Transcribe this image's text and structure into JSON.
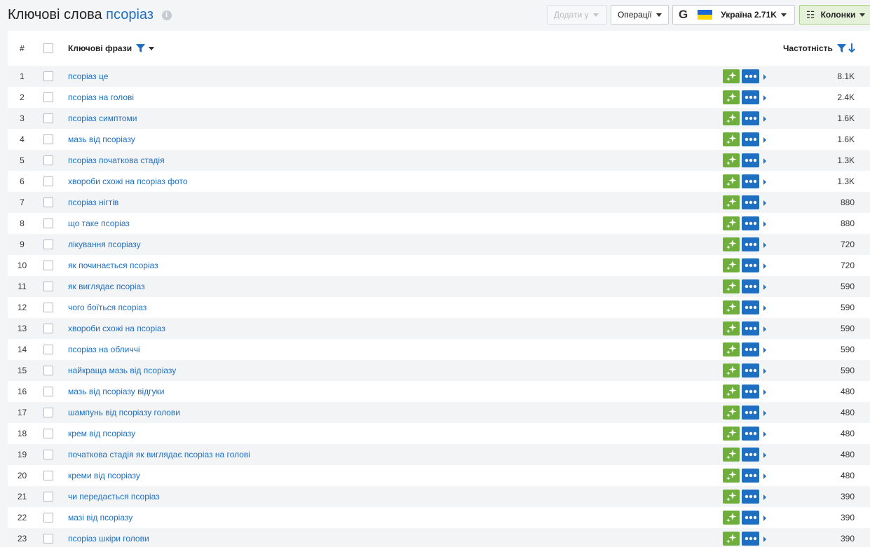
{
  "header": {
    "title_prefix": "Ключові слова",
    "title_keyword": "псоріаз",
    "info_glyph": "i",
    "add_label": "Додати у",
    "operations_label": "Операції",
    "search_engine_glyph": "G",
    "region_label": "Україна 2.71K",
    "columns_label": "Колонки"
  },
  "table": {
    "columns": {
      "num": "#",
      "keyword": "Ключові фрази",
      "frequency": "Частотність"
    },
    "rows": [
      {
        "num": "1",
        "keyword": "псоріаз це",
        "frequency": "8.1K"
      },
      {
        "num": "2",
        "keyword": "псоріаз на голові",
        "frequency": "2.4K"
      },
      {
        "num": "3",
        "keyword": "псоріаз симптоми",
        "frequency": "1.6K"
      },
      {
        "num": "4",
        "keyword": "мазь від псоріазу",
        "frequency": "1.6K"
      },
      {
        "num": "5",
        "keyword": "псоріаз початкова стадія",
        "frequency": "1.3K"
      },
      {
        "num": "6",
        "keyword": "хвороби схожі на псоріаз фото",
        "frequency": "1.3K"
      },
      {
        "num": "7",
        "keyword": "псоріаз нігтів",
        "frequency": "880"
      },
      {
        "num": "8",
        "keyword": "що таке псоріаз",
        "frequency": "880"
      },
      {
        "num": "9",
        "keyword": "лікування псоріазу",
        "frequency": "720"
      },
      {
        "num": "10",
        "keyword": "як починається псоріаз",
        "frequency": "720"
      },
      {
        "num": "11",
        "keyword": "як виглядає псоріаз",
        "frequency": "590"
      },
      {
        "num": "12",
        "keyword": "чого боїться псоріаз",
        "frequency": "590"
      },
      {
        "num": "13",
        "keyword": "хвороби схожі на псоріаз",
        "frequency": "590"
      },
      {
        "num": "14",
        "keyword": "псоріаз на обличчі",
        "frequency": "590"
      },
      {
        "num": "15",
        "keyword": "найкраща мазь від псоріазу",
        "frequency": "590"
      },
      {
        "num": "16",
        "keyword": "мазь від псоріазу відгуки",
        "frequency": "480"
      },
      {
        "num": "17",
        "keyword": "шампунь від псоріазу голови",
        "frequency": "480"
      },
      {
        "num": "18",
        "keyword": "крем від псоріазу",
        "frequency": "480"
      },
      {
        "num": "19",
        "keyword": "початкова стадія як виглядає псоріаз на голові",
        "frequency": "480"
      },
      {
        "num": "20",
        "keyword": "креми від псоріазу",
        "frequency": "480"
      },
      {
        "num": "21",
        "keyword": "чи передається псоріаз",
        "frequency": "390"
      },
      {
        "num": "22",
        "keyword": "мазі від псоріазу",
        "frequency": "390"
      },
      {
        "num": "23",
        "keyword": "псоріаз шкіри голови",
        "frequency": "390"
      }
    ]
  },
  "colors": {
    "accent_blue": "#1e6fc1",
    "accent_green": "#6fae3c",
    "columns_button_bg": "#e5f2d9"
  },
  "icons": {
    "info": "info-icon",
    "filter": "filter-icon",
    "sort": "arrow-down-icon",
    "row_spark": "sparkle-icon",
    "row_more": "more-dots-icon",
    "flag": "ukraine-flag-icon",
    "columns": "columns-icon"
  }
}
